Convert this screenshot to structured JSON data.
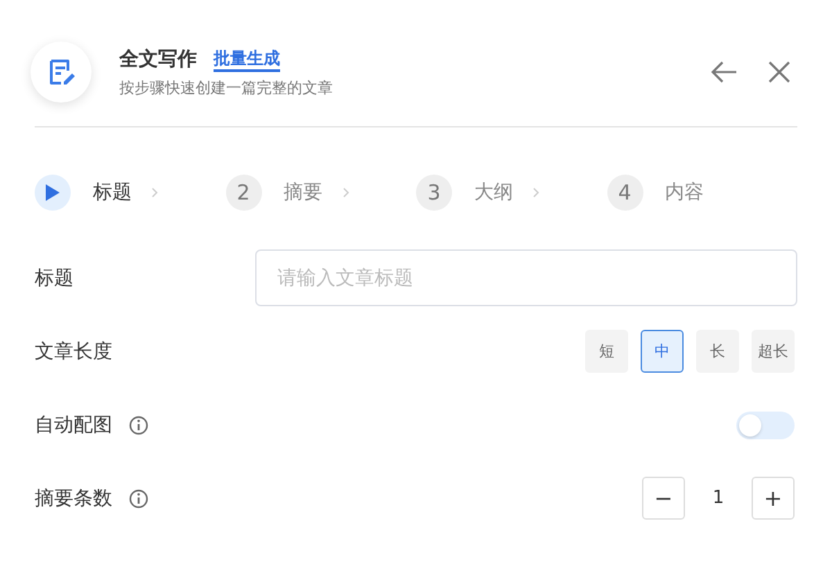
{
  "header": {
    "title": "全文写作",
    "link": "批量生成",
    "subtitle": "按步骤快速创建一篇完整的文章"
  },
  "steps": [
    {
      "label": "标题",
      "selected": true
    },
    {
      "number": "2",
      "label": "摘要",
      "selected": false
    },
    {
      "number": "3",
      "label": "大纲",
      "selected": false
    },
    {
      "number": "4",
      "label": "内容",
      "selected": false
    }
  ],
  "form": [
    {
      "kind": "input",
      "label": "标题",
      "placeholder": "请输入文章标题"
    },
    {
      "kind": "segmented",
      "label": "文章长度",
      "options": [
        {
          "label": "短",
          "selected": false
        },
        {
          "label": "中",
          "selected": true
        },
        {
          "label": "长",
          "selected": false
        },
        {
          "label": "超长",
          "selected": false
        }
      ]
    },
    {
      "kind": "toggle",
      "label": "自动配图",
      "info": true,
      "on": false
    },
    {
      "kind": "stepper",
      "label": "摘要条数",
      "info": true,
      "minus": "−",
      "value": "1",
      "plus": "+"
    }
  ]
}
